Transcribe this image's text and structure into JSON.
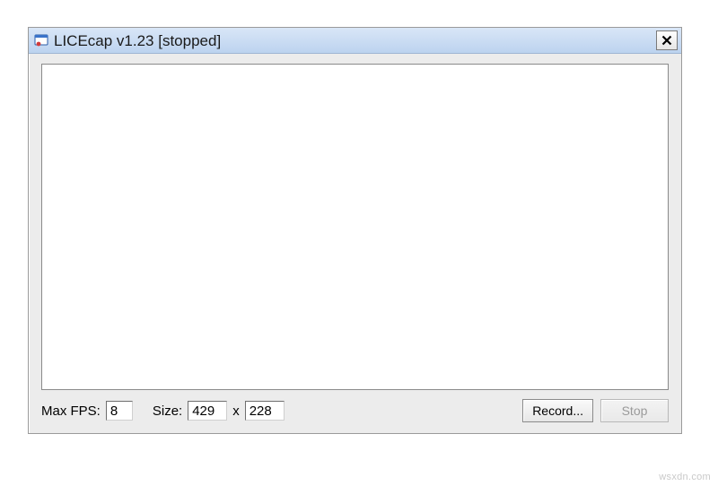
{
  "window": {
    "title": "LICEcap v1.23 [stopped]"
  },
  "toolbar": {
    "max_fps_label": "Max FPS:",
    "max_fps_value": "8",
    "size_label": "Size:",
    "size_width": "429",
    "size_sep": "x",
    "size_height": "228",
    "record_label": "Record...",
    "stop_label": "Stop"
  },
  "watermark": "wsxdn.com"
}
